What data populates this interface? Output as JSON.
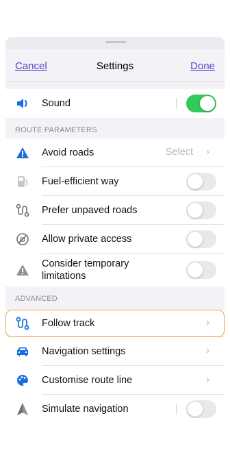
{
  "header": {
    "cancel_label": "Cancel",
    "title": "Settings",
    "done_label": "Done"
  },
  "sound": {
    "label": "Sound",
    "enabled": true
  },
  "route_parameters": {
    "section_title": "ROUTE PARAMETERS",
    "avoid_roads": {
      "label": "Avoid roads",
      "value": "Select"
    },
    "fuel_efficient": {
      "label": "Fuel-efficient way",
      "enabled": false
    },
    "prefer_unpaved": {
      "label": "Prefer unpaved roads",
      "enabled": false
    },
    "private_access": {
      "label": "Allow private access",
      "enabled": false
    },
    "temporary_limitations": {
      "label_line1": "Consider temporary",
      "label_line2": "limitations",
      "enabled": false
    }
  },
  "advanced": {
    "section_title": "ADVANCED",
    "follow_track": {
      "label": "Follow track"
    },
    "navigation_settings": {
      "label": "Navigation settings"
    },
    "customise_route_line": {
      "label": "Customise route line"
    },
    "simulate_navigation": {
      "label": "Simulate navigation",
      "enabled": false
    }
  },
  "chevron": "›",
  "colors": {
    "accent": "#5a3fc4",
    "toggle_on": "#34c759",
    "icon_blue": "#1a6fe0",
    "highlight": "#f0a032"
  }
}
